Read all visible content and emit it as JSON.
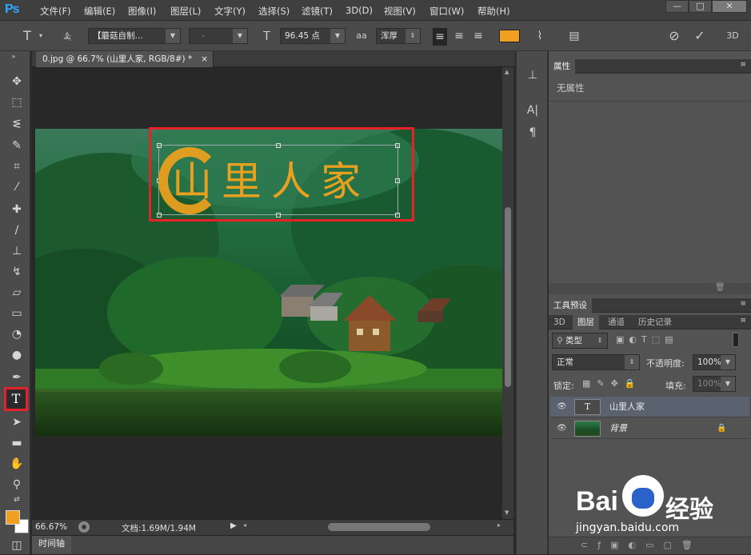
{
  "app": {
    "logo": "Ps"
  },
  "menu": [
    "文件(F)",
    "编辑(E)",
    "图像(I)",
    "图层(L)",
    "文字(Y)",
    "选择(S)",
    "滤镜(T)",
    "3D(D)",
    "视图(V)",
    "窗口(W)",
    "帮助(H)"
  ],
  "window_controls": {
    "minimize": "—",
    "restore": "□",
    "close": "✕"
  },
  "options": {
    "font_family": "【蘑菇自制…",
    "font_style": "-",
    "font_size": "96.45 点",
    "antialias_icon_label": "aa",
    "antialias": "浑厚",
    "text_color": "#f0a020",
    "confirm_symbol": "✓",
    "cancel_symbol": "⊘",
    "threed_label": "3D"
  },
  "document": {
    "tab_title": "0.jpg @ 66.7% (山里人家, RGB/8#) *",
    "close": "×"
  },
  "canvas_text": "山里人家",
  "status": {
    "zoom": "66.67%",
    "doc_info": "文档:1.69M/1.94M"
  },
  "timeline": {
    "label": "时间轴"
  },
  "properties": {
    "tab": "属性",
    "content": "无属性"
  },
  "tool_presets": {
    "tab": "工具预设"
  },
  "layers_panel": {
    "tabs": [
      "3D",
      "图层",
      "通道",
      "历史记录"
    ],
    "active_tab": "图层",
    "filter": "类型",
    "blend_mode": "正常",
    "opacity_label": "不透明度:",
    "opacity": "100%",
    "lock_label": "锁定:",
    "fill_label": "填充:",
    "fill": "100%",
    "layers": [
      {
        "name": "山里人家",
        "type": "text",
        "selected": true,
        "thumb_label": "T"
      },
      {
        "name": "背景",
        "type": "image",
        "selected": false
      }
    ]
  },
  "watermark": {
    "brand_text": "Bai",
    "brand_text2": "经验",
    "url": "jingyan.baidu.com"
  },
  "highlight_color": "#e8202a"
}
